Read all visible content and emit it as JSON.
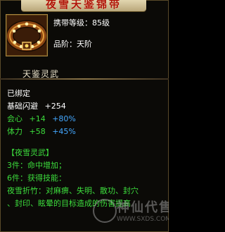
{
  "tooltip": {
    "title": "夜雪天鉴锦带",
    "carry_level": "携带等级：85级",
    "grade": "品阶：天阶",
    "item_name": "天鉴灵武",
    "bound": "已绑定",
    "stats": [
      {
        "label": "基础闪避",
        "value": "+254",
        "extra": ""
      },
      {
        "label": "会心",
        "value": "+14",
        "extra": "+80%"
      },
      {
        "label": "体力",
        "value": "+58",
        "extra": "+45%"
      }
    ],
    "set": {
      "header": "【夜雪灵武】",
      "piece3": "3件：命中增加；",
      "piece6": "6件：获得技能：",
      "skill_line1": "夜雪折竹：对麻痹、失明、散功、封穴",
      "skill_line2": "、封印、眩晕的目标造成的伤害提高"
    },
    "icon": "belt-item-icon"
  },
  "watermark": {
    "text": "神仙代售",
    "url": "WWW.SXDS.COM"
  },
  "colors": {
    "title": "#b0140a",
    "stat_green": "#3cdc3c",
    "stat_blue": "#44a8ff",
    "text_white": "#ffffff"
  }
}
